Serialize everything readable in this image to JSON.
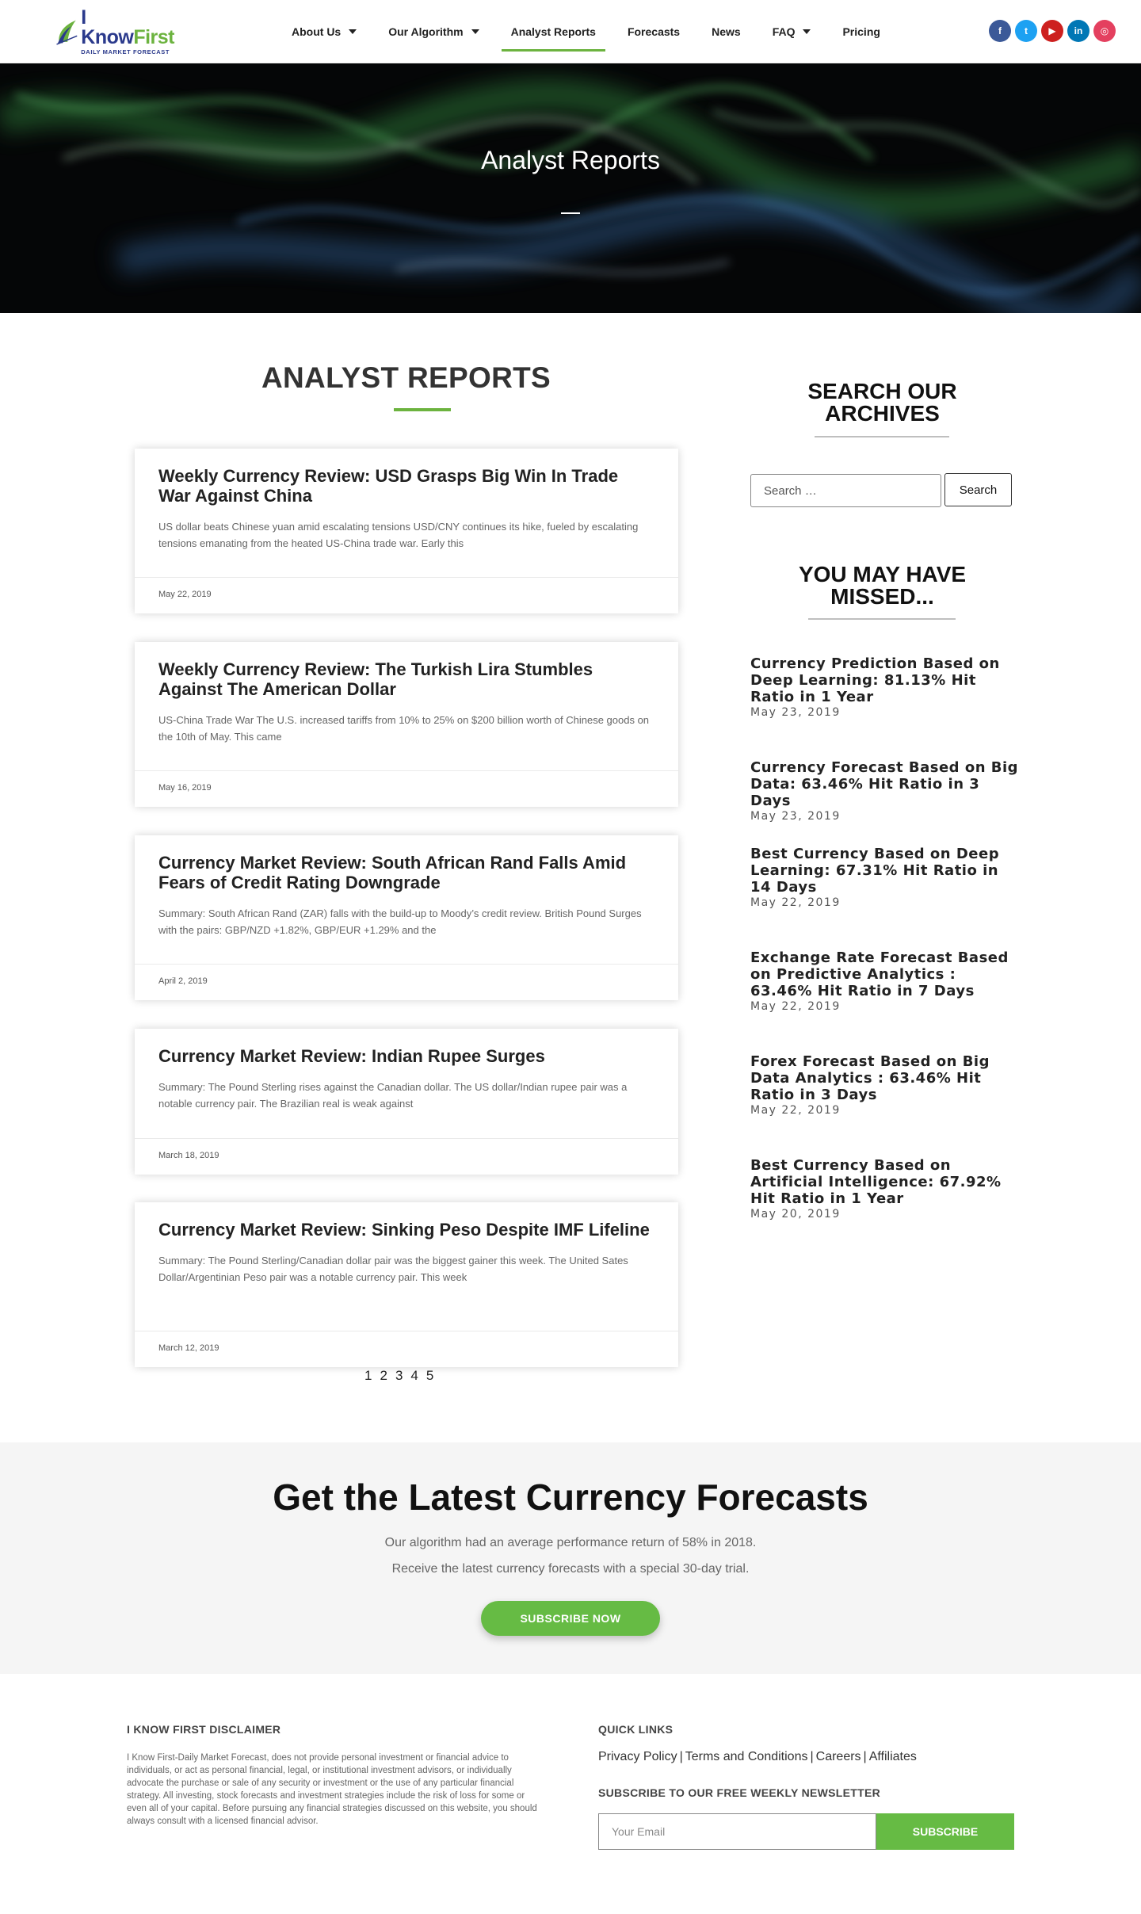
{
  "brand": {
    "name_a": "I Know",
    "name_b": "First",
    "tagline": "DAILY MARKET FORECAST",
    "green": "#6cb33f",
    "navy": "#2b3a8c"
  },
  "nav": {
    "items": [
      {
        "label": "About Us",
        "dropdown": true
      },
      {
        "label": "Our Algorithm",
        "dropdown": true
      },
      {
        "label": "Analyst Reports",
        "dropdown": false,
        "active": true
      },
      {
        "label": "Forecasts",
        "dropdown": false
      },
      {
        "label": "News",
        "dropdown": false
      },
      {
        "label": "FAQ",
        "dropdown": true
      },
      {
        "label": "Pricing",
        "dropdown": false
      }
    ]
  },
  "social": [
    {
      "name": "facebook-icon",
      "glyph": "f",
      "color": "#3b5998"
    },
    {
      "name": "twitter-icon",
      "glyph": "t",
      "color": "#1da1f2"
    },
    {
      "name": "youtube-icon",
      "glyph": "▶",
      "color": "#cd201f"
    },
    {
      "name": "linkedin-icon",
      "glyph": "in",
      "color": "#0077b5"
    },
    {
      "name": "instagram-icon",
      "glyph": "◎",
      "color": "#e4405f"
    }
  ],
  "hero": {
    "title": "Analyst Reports"
  },
  "main": {
    "title": "ANALYST REPORTS",
    "posts": [
      {
        "title": "Weekly Currency Review: USD Grasps Big Win In Trade War Against China",
        "excerpt": "US dollar beats Chinese yuan amid escalating tensions USD/CNY continues its hike, fueled by escalating tensions emanating from the heated US-China trade war. Early this",
        "date": "May 22, 2019"
      },
      {
        "title": "Weekly Currency Review: The Turkish Lira Stumbles Against The American Dollar",
        "excerpt": "US-China Trade War The U.S. increased tariffs from 10% to 25% on $200 billion worth of Chinese goods on the 10th of May. This came",
        "date": "May 16, 2019"
      },
      {
        "title": "Currency Market Review: South African Rand Falls Amid Fears of Credit Rating Downgrade",
        "excerpt": "Summary: South African Rand (ZAR) falls with the build-up to Moody’s credit review. British Pound Surges with the pairs: GBP/NZD +1.82%, GBP/EUR +1.29% and the",
        "date": "April 2, 2019"
      },
      {
        "title": "Currency Market Review: Indian Rupee Surges",
        "excerpt": "Summary: The Pound Sterling rises against the Canadian dollar. The US dollar/Indian rupee pair was a notable currency pair. The Brazilian real is weak against",
        "date": "March 18, 2019"
      },
      {
        "title": "Currency Market Review: Sinking Peso Despite IMF Lifeline",
        "excerpt": "Summary: The Pound Sterling/Canadian dollar pair was the biggest gainer this week. The United Sates Dollar/Argentinian Peso pair was a notable currency pair. This week",
        "date": "March 12, 2019"
      }
    ],
    "pagination": [
      "1",
      "2",
      "3",
      "4",
      "5"
    ]
  },
  "sidebar": {
    "search_heading_1": "SEARCH OUR",
    "search_heading_2": "ARCHIVES",
    "search_placeholder": "Search …",
    "search_button": "Search",
    "missed_heading_1": "YOU MAY HAVE",
    "missed_heading_2": "MISSED...",
    "missed": [
      {
        "title": "Currency Prediction Based on Deep Learning: 81.13% Hit Ratio in 1 Year",
        "date": "May 23, 2019"
      },
      {
        "title": "Currency Forecast Based on Big Data: 63.46% Hit Ratio in 3 Days",
        "date": "May 23, 2019"
      },
      {
        "title": "Best Currency Based on Deep Learning: 67.31% Hit Ratio in 14 Days",
        "date": "May 22, 2019"
      },
      {
        "title": "Exchange Rate Forecast Based on Predictive Analytics : 63.46% Hit Ratio in 7 Days",
        "date": "May 22, 2019"
      },
      {
        "title": "Forex Forecast Based on Big Data Analytics : 63.46% Hit Ratio in 3 Days",
        "date": "May 22, 2019"
      },
      {
        "title": "Best Currency Based on Artificial Intelligence: 67.92% Hit Ratio in 1 Year",
        "date": "May 20, 2019"
      }
    ]
  },
  "cta": {
    "title": "Get the Latest Currency Forecasts",
    "line1": "Our algorithm had an average performance return of 58% in 2018.",
    "line2": "Receive the latest currency forecasts with a special 30-day trial.",
    "button": "SUBSCRIBE NOW"
  },
  "footer": {
    "disclaimer_heading": "I KNOW FIRST DISCLAIMER",
    "disclaimer_text": "I Know First-Daily Market Forecast, does not provide personal investment or financial advice to individuals, or act as personal financial, legal, or institutional investment advisors, or individually advocate the purchase or sale of any security or investment or the use of any particular financial strategy. All investing, stock forecasts and investment strategies include the risk of loss for some or even all of your capital. Before pursuing any financial strategies discussed on this website, you should always consult with a licensed financial advisor.",
    "quick_links_heading": "QUICK LINKS",
    "quick_links": [
      "Privacy Policy",
      "Terms and Conditions",
      "Careers",
      "Affiliates"
    ],
    "newsletter_heading": "SUBSCRIBE TO OUR FREE WEEKLY NEWSLETTER",
    "newsletter_placeholder": "Your Email",
    "newsletter_button": "SUBSCRIBE"
  }
}
